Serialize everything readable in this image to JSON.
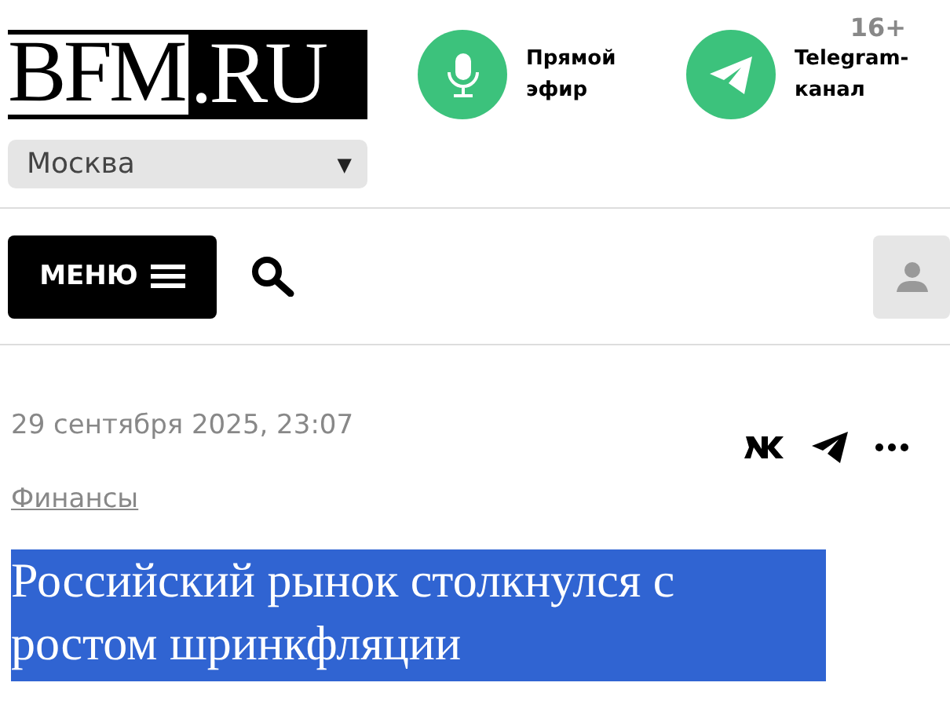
{
  "logo": {
    "left": "BFM",
    "right": ".RU"
  },
  "city_select": {
    "value": "Москва",
    "arrow": "▼"
  },
  "age_rating": "16+",
  "header_links": [
    {
      "kind": "live",
      "label": "Прямой эфир"
    },
    {
      "kind": "telegram",
      "label": "Telegram-канал"
    }
  ],
  "menu_button": {
    "label": "МЕНЮ"
  },
  "article": {
    "date": "29 сентября 2025, 23:07",
    "category": "Финансы",
    "title": "Российский рынок столкнулся с ростом шринкфляции",
    "title_selected": true,
    "share": [
      {
        "kind": "vk"
      },
      {
        "kind": "telegram"
      },
      {
        "kind": "more"
      }
    ]
  }
}
